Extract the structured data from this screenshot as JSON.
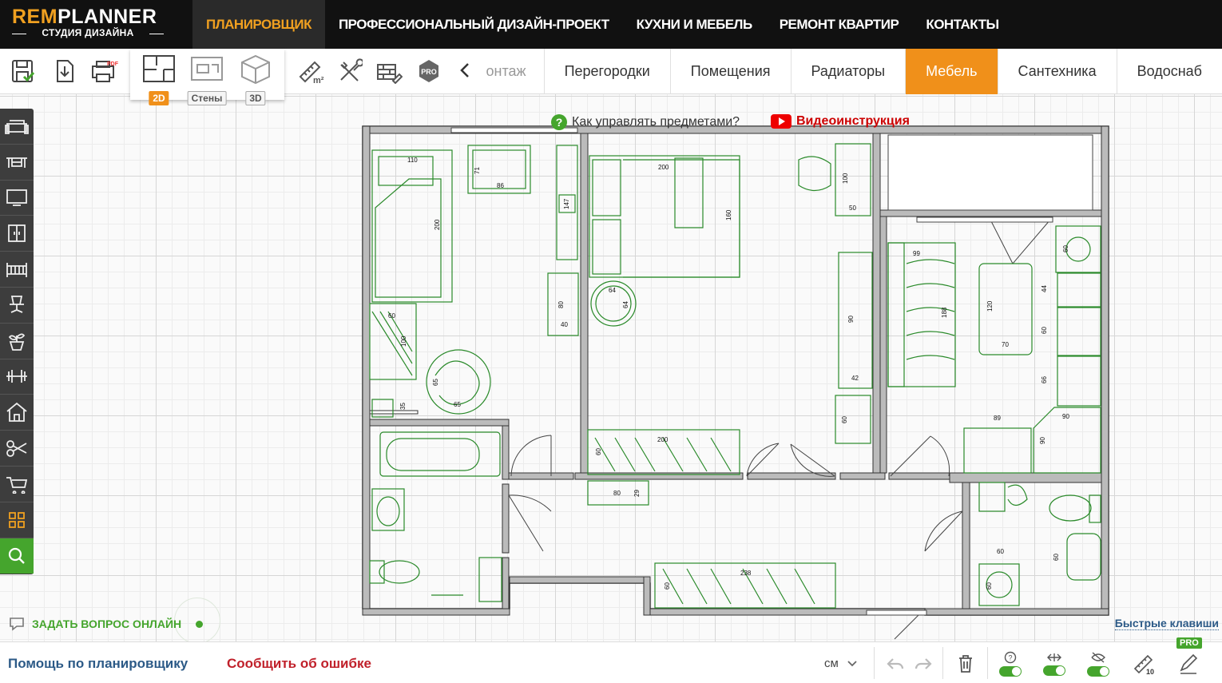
{
  "logo": {
    "brand_part1": "REM",
    "brand_part2": "PLANNER",
    "subtitle": "СТУДИЯ ДИЗАЙНА"
  },
  "nav": {
    "items": [
      {
        "label": "ПЛАНИРОВЩИК",
        "active": true
      },
      {
        "label": "ПРОФЕССИОНАЛЬНЫЙ ДИЗАЙН-ПРОЕКТ"
      },
      {
        "label": "КУХНИ И МЕБЕЛЬ"
      },
      {
        "label": "РЕМОНТ КВАРТИР"
      },
      {
        "label": "КОНТАКТЫ"
      }
    ]
  },
  "toolbar": {
    "view_modes": [
      {
        "label": "2D",
        "active": true
      },
      {
        "label": "Стены"
      },
      {
        "label": "3D"
      }
    ],
    "pro_label": "PRO",
    "icons": [
      "save-icon",
      "export-icon",
      "pdf-icon",
      "area-ruler-icon",
      "tools-icon",
      "bricks-icon",
      "pro-icon"
    ]
  },
  "tabs": {
    "partial_label": "онтаж",
    "items": [
      {
        "label": "Перегородки"
      },
      {
        "label": "Помещения"
      },
      {
        "label": "Радиаторы"
      },
      {
        "label": "Мебель",
        "active": true
      },
      {
        "label": "Сантехника"
      },
      {
        "label": "Водоснаб"
      }
    ]
  },
  "sidebar": {
    "items": [
      "sofa-icon",
      "table-icon",
      "tv-icon",
      "wardrobe-icon",
      "crib-icon",
      "office-chair-icon",
      "plant-icon",
      "dumbbell-icon",
      "house-icon",
      "scissors-icon",
      "cart-icon",
      "grid-icon",
      "search-icon"
    ]
  },
  "canvas": {
    "help_text": "Как управлять предметами?",
    "video_text": "Видеоинструкция",
    "ask_online": "ЗАДАТЬ ВОПРОС ОНЛАЙН",
    "hotkeys": "Быстрые клавиши",
    "dims": {
      "d110": "110",
      "d200a": "200",
      "d71": "71",
      "d86": "86",
      "d147": "147",
      "d200b": "200",
      "d160": "160",
      "d100a": "100",
      "d50": "50",
      "d64a": "64",
      "d64b": "64",
      "d80a": "80",
      "d40": "40",
      "d60a": "60",
      "d100b": "100",
      "d65a": "65",
      "d65b": "65",
      "d35": "35",
      "d90a": "90",
      "d42": "42",
      "d60b": "60",
      "d99": "99",
      "d188": "188",
      "d120": "120",
      "d70": "70",
      "d60c": "60",
      "d44": "44",
      "d60d": "60",
      "d66": "66",
      "d89": "89",
      "d90b": "90",
      "d90c": "90",
      "d200c": "200",
      "d60e": "60",
      "d80b": "80",
      "d29": "29",
      "d238": "238",
      "d60f": "60",
      "d60g": "60",
      "d60h": "60",
      "d60i": "60"
    }
  },
  "bottombar": {
    "help": "Помощь по планировщику",
    "report": "Сообщить об ошибке",
    "units": "см",
    "measure_label": "10",
    "pro_label": "PRO"
  },
  "colors": {
    "accent": "#f0901a",
    "green": "#45a52d",
    "furniture": "#2a8a2a",
    "link_blue": "#2c5a87",
    "error_red": "#c0202a"
  }
}
